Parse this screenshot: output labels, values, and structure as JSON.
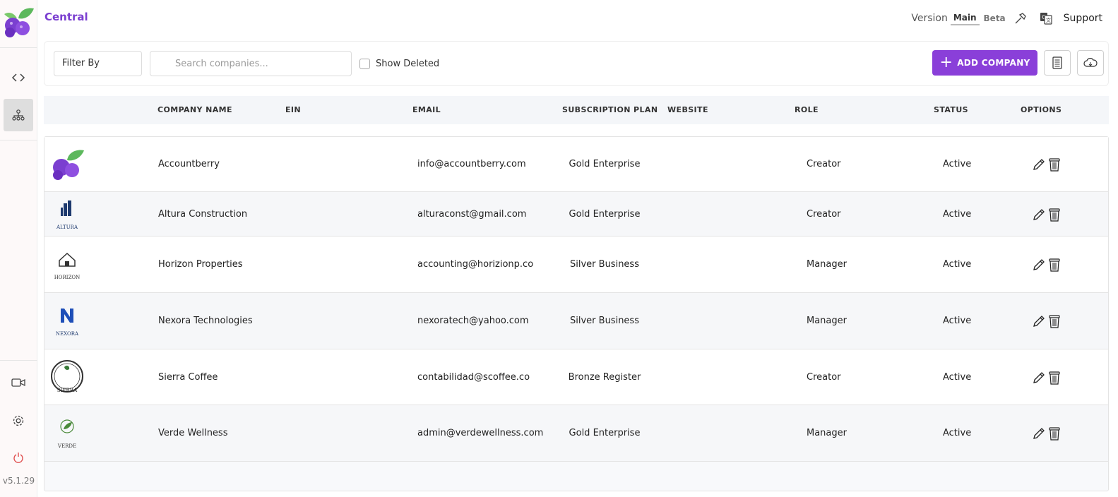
{
  "app": {
    "title": "Central",
    "version": "v5.1.29"
  },
  "header": {
    "version_label": "Version",
    "version_main": "Main",
    "version_beta": "Beta",
    "support_label": "Support",
    "icons": [
      "hammer-icon",
      "translate-icon"
    ]
  },
  "sidebar": {
    "items": [
      {
        "icon": "code-icon",
        "active": false
      },
      {
        "icon": "org-chart-icon",
        "active": true
      },
      {
        "icon": "video-icon",
        "active": false
      },
      {
        "icon": "gear-icon",
        "active": false
      },
      {
        "icon": "power-icon",
        "active": false
      }
    ]
  },
  "toolbar": {
    "filter_label": "Filter By",
    "search_placeholder": "Search companies...",
    "show_deleted_label": "Show Deleted",
    "add_company_label": "ADD COMPANY",
    "accent": "#8a3fd9"
  },
  "table": {
    "columns": [
      "COMPANY NAME",
      "EIN",
      "EMAIL",
      "SUBSCRIPTION PLAN",
      "WEBSITE",
      "ROLE",
      "STATUS",
      "OPTIONS"
    ],
    "rows": [
      {
        "name": "Accountberry",
        "ein": "",
        "email": "info@accountberry.com",
        "plan": "Gold Enterprise",
        "website": "",
        "role": "Creator",
        "status": "Active",
        "logo_text": "",
        "logo_icon": "berry-logo-icon"
      },
      {
        "name": "Altura Construction",
        "ein": "",
        "email": "alturaconst@gmail.com",
        "plan": "Gold Enterprise",
        "website": "",
        "role": "Creator",
        "status": "Active",
        "logo_text": "ALTURA",
        "logo_icon": "building-logo-icon"
      },
      {
        "name": "Horizon Properties",
        "ein": "",
        "email": "accounting@horizionp.co",
        "plan": "Silver Business",
        "website": "",
        "role": "Manager",
        "status": "Active",
        "logo_text": "HORIZON",
        "logo_icon": "house-logo-icon"
      },
      {
        "name": "Nexora Technologies",
        "ein": "",
        "email": "nexoratech@yahoo.com",
        "plan": "Silver Business",
        "website": "",
        "role": "Manager",
        "status": "Active",
        "logo_text": "NEXORA",
        "logo_icon": "n-letter-logo-icon"
      },
      {
        "name": "Sierra Coffee",
        "ein": "",
        "email": "contabilidad@scoffee.co",
        "plan": "Bronze Register",
        "website": "",
        "role": "Creator",
        "status": "Active",
        "logo_text": "SIERRA",
        "logo_icon": "coffee-seal-logo-icon"
      },
      {
        "name": "Verde Wellness",
        "ein": "",
        "email": "admin@verdewellness.com",
        "plan": "Gold Enterprise",
        "website": "",
        "role": "Manager",
        "status": "Active",
        "logo_text": "VERDE",
        "logo_icon": "leaf-logo-icon"
      }
    ]
  }
}
